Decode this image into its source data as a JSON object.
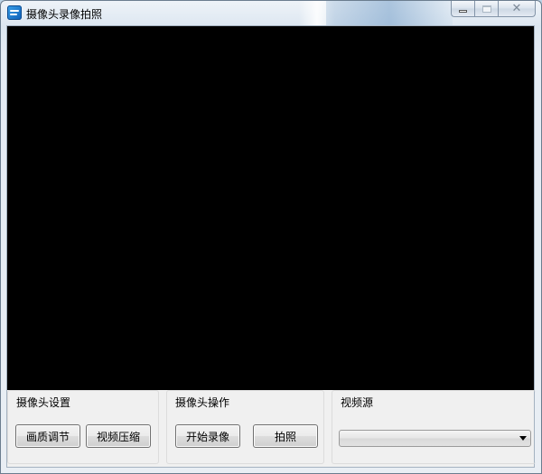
{
  "window": {
    "title": "摄像头录像拍照"
  },
  "groups": {
    "camera_settings": {
      "label": "摄像头设置",
      "buttons": {
        "quality": "画质调节",
        "compression": "视频压缩"
      }
    },
    "camera_operations": {
      "label": "摄像头操作",
      "buttons": {
        "record": "开始录像",
        "photo": "拍照"
      }
    },
    "video_source": {
      "label": "视频源",
      "selected": ""
    }
  },
  "icons": {
    "app": "app-icon",
    "minimize": "minimize-icon",
    "maximize": "maximize-icon",
    "close": "close-icon",
    "dropdown": "chevron-down-icon"
  },
  "colors": {
    "video_background": "#000000",
    "client_background": "#f0f0f0"
  }
}
